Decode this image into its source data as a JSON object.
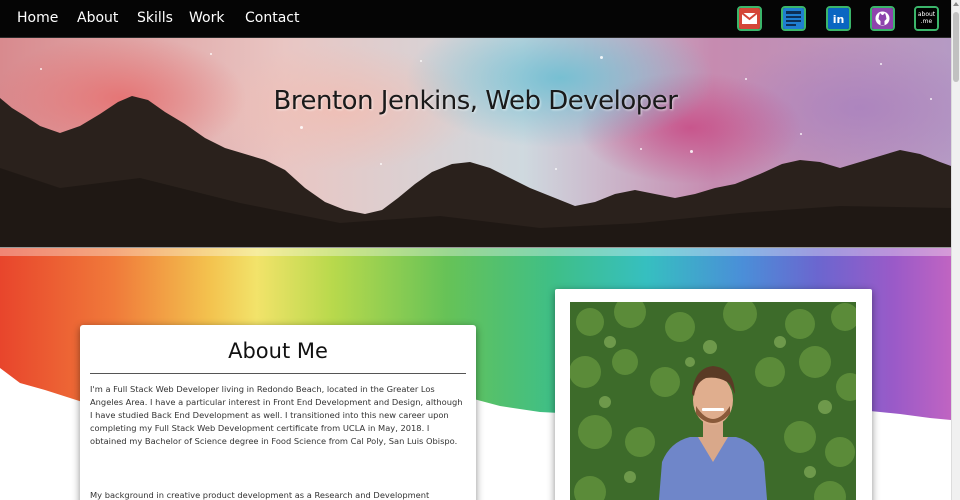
{
  "nav": {
    "links": [
      "Home",
      "About",
      "Skills",
      "Work",
      "Contact"
    ],
    "social_icons": [
      {
        "icon": "gmail-icon",
        "label": "Gmail"
      },
      {
        "icon": "resume-icon",
        "label": "Resume"
      },
      {
        "icon": "linkedin-icon",
        "label": "in"
      },
      {
        "icon": "github-icon",
        "label": "GitHub"
      },
      {
        "icon": "aboutme-icon",
        "label": "about me",
        "line1": "about",
        "line2": ".me"
      }
    ]
  },
  "hero": {
    "title": "Brenton Jenkins, Web Developer"
  },
  "about": {
    "heading": "About Me",
    "paragraph1": "I'm a Full Stack Web Developer living in Redondo Beach, located in the Greater Los Angeles Area. I have a particular interest in Front End Development and Design, although I have studied Back End Development as well. I transitioned into this new career upon completing my Full Stack Web Development certificate from UCLA in May, 2018. I obtained my Bachelor of Science degree in Food Science from Cal Poly, San Luis Obispo.",
    "paragraph2": "My background in creative product development as a Research and Development"
  },
  "colors": {
    "nav_bg": "#050505",
    "icon_border": "#3bb56a",
    "gmail_red": "#d44638",
    "linkedin_blue": "#0a66c2",
    "github_purple": "#8e44ad"
  }
}
